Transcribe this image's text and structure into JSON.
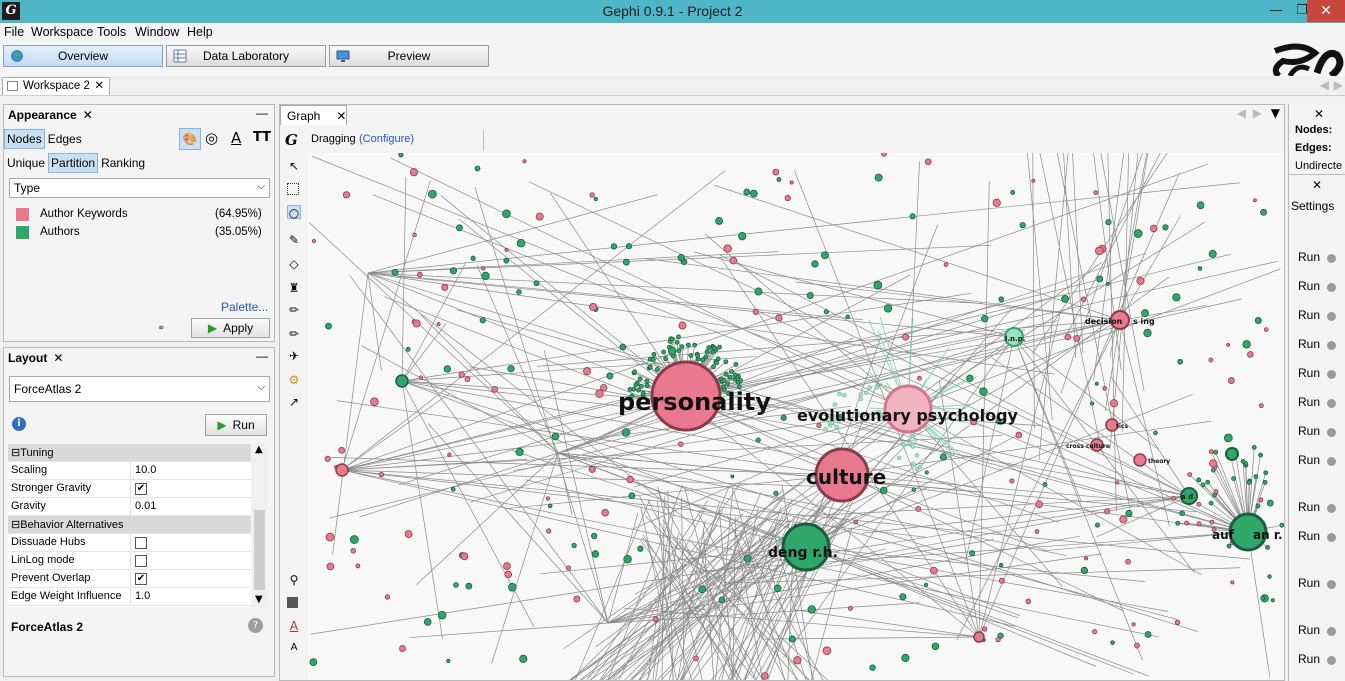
{
  "window": {
    "title": "Gephi 0.9.1 - Project 2",
    "app_icon": "gephi-logo-icon"
  },
  "menu": [
    "File",
    "Workspace",
    "Tools",
    "Window",
    "Help"
  ],
  "modes": {
    "overview": "Overview",
    "data_lab": "Data Laboratory",
    "preview": "Preview"
  },
  "workspace_tab": "Workspace 2",
  "appearance": {
    "title": "Appearance",
    "element_tabs": [
      "Nodes",
      "Edges"
    ],
    "mode_tabs": [
      "Unique",
      "Partition",
      "Ranking"
    ],
    "attribute": "Type",
    "partitions": [
      {
        "label": "Author Keywords",
        "pct": "(64.95%)",
        "color": "#e8798f"
      },
      {
        "label": "Authors",
        "pct": "(35.05%)",
        "color": "#2fa66a"
      }
    ],
    "palette_link": "Palette...",
    "apply_label": "Apply"
  },
  "layout": {
    "title": "Layout",
    "algorithm": "ForceAtlas 2",
    "run_label": "Run",
    "properties": {
      "tuning": "Tuning",
      "scaling_k": "Scaling",
      "scaling_v": "10.0",
      "stronger_gravity_k": "Stronger Gravity",
      "gravity_k": "Gravity",
      "gravity_v": "0.01",
      "behavior": "Behavior Alternatives",
      "dissuade_k": "Dissuade Hubs",
      "linlog_k": "LinLog mode",
      "overlap_k": "Prevent Overlap",
      "edgeweight_k": "Edge Weight Influence",
      "edgeweight_v": "1.0"
    },
    "footer": "ForceAtlas 2"
  },
  "graph": {
    "tab": "Graph",
    "mode": "Dragging",
    "configure": "(Configure)",
    "labels": {
      "personality": "personality",
      "evo": "evolutionary psychology",
      "culture": "culture",
      "deng": "deng r.h.",
      "auf": "auf",
      "anr": "an r.",
      "decision": "decision",
      "making": "s ing",
      "lnp": "l.n.p.",
      "ad": "a d",
      "tics": "tics",
      "cross": "cross culture",
      "theory": "theory"
    }
  },
  "context": {
    "nodes": "Nodes:",
    "edges": "Edges:",
    "undirected": "Undirecte",
    "settings": "Settings"
  },
  "statistics": {
    "run_label": "Run"
  }
}
